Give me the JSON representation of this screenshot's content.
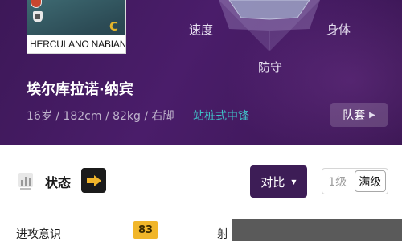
{
  "card": {
    "player_name_plate": "HERCULANO NABIAN",
    "grade": "C"
  },
  "radar": {
    "labels": {
      "speed": "速度",
      "physical": "身体",
      "defense": "防守"
    }
  },
  "player": {
    "name": "埃尔库拉诺·纳宾",
    "info": "16岁 / 182cm / 82kg / 右脚",
    "position": "站桩式中锋"
  },
  "kit_button": {
    "label": "队套"
  },
  "status": {
    "label": "状态"
  },
  "compare_button": {
    "label": "对比"
  },
  "level": {
    "option1": "1级",
    "option2": "满级",
    "selected": "满级"
  },
  "attributes": {
    "row1_label": "进攻意识",
    "row1_value": "83",
    "row2_label": "射"
  },
  "colors": {
    "header_bg": "#45195f",
    "accent_teal": "#40c4c9",
    "value_badge": "#f1b62a",
    "compare_bg": "#3d1d56"
  }
}
